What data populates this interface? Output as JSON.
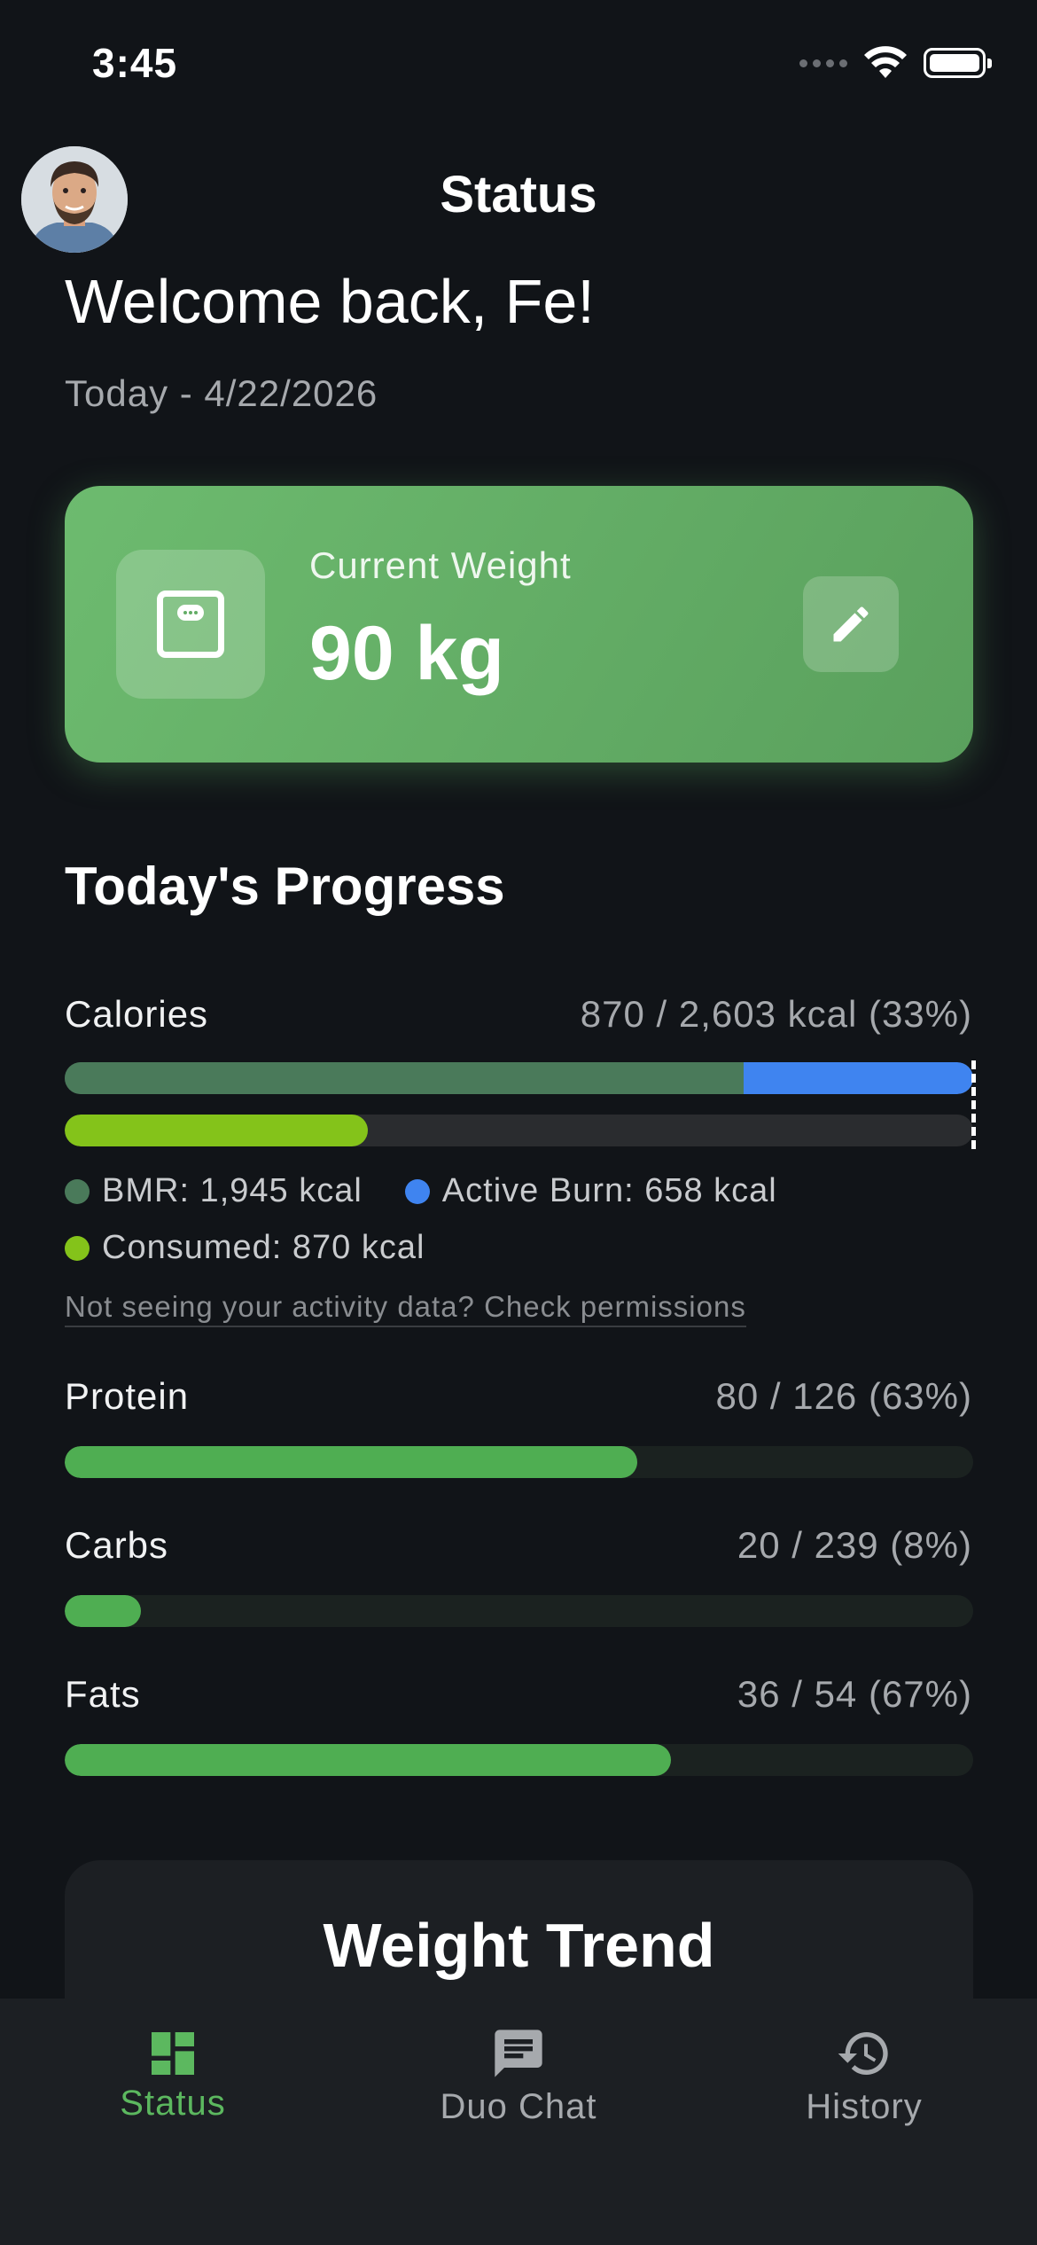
{
  "status_bar": {
    "time": "3:45"
  },
  "header": {
    "title": "Status"
  },
  "greeting": {
    "welcome": "Welcome back, Fe!",
    "date": "Today - 4/22/2026"
  },
  "weight_card": {
    "label": "Current Weight",
    "value": "90 kg"
  },
  "progress": {
    "title": "Today's Progress",
    "calories": {
      "label": "Calories",
      "value": "870 / 2,603 kcal (33%)",
      "bmr_fraction_of_goal": 0.747,
      "active_fraction_of_goal": 0.253,
      "consumed_fraction_of_goal": 0.334,
      "legend": {
        "bmr": "BMR: 1,945 kcal",
        "active": "Active Burn: 658 kcal",
        "consumed": "Consumed: 870 kcal"
      },
      "permissions_link": "Not seeing your activity data? Check permissions"
    },
    "macros": [
      {
        "label": "Protein",
        "value": "80 / 126 (63%)",
        "fraction": 0.63
      },
      {
        "label": "Carbs",
        "value": "20 / 239 (8%)",
        "fraction": 0.084
      },
      {
        "label": "Fats",
        "value": "36 / 54 (67%)",
        "fraction": 0.667
      }
    ]
  },
  "weight_trend": {
    "title": "Weight Trend"
  },
  "tabs": [
    {
      "label": "Status",
      "icon": "dashboard-icon",
      "active": true
    },
    {
      "label": "Duo Chat",
      "icon": "chat-icon",
      "active": false
    },
    {
      "label": "History",
      "icon": "history-icon",
      "active": false
    }
  ],
  "colors": {
    "accent_green": "#5cb85f",
    "bmr": "#4a7a5a",
    "active_burn": "#3f84f0",
    "consumed": "#84c31a",
    "macro_fill": "#4fae52"
  }
}
